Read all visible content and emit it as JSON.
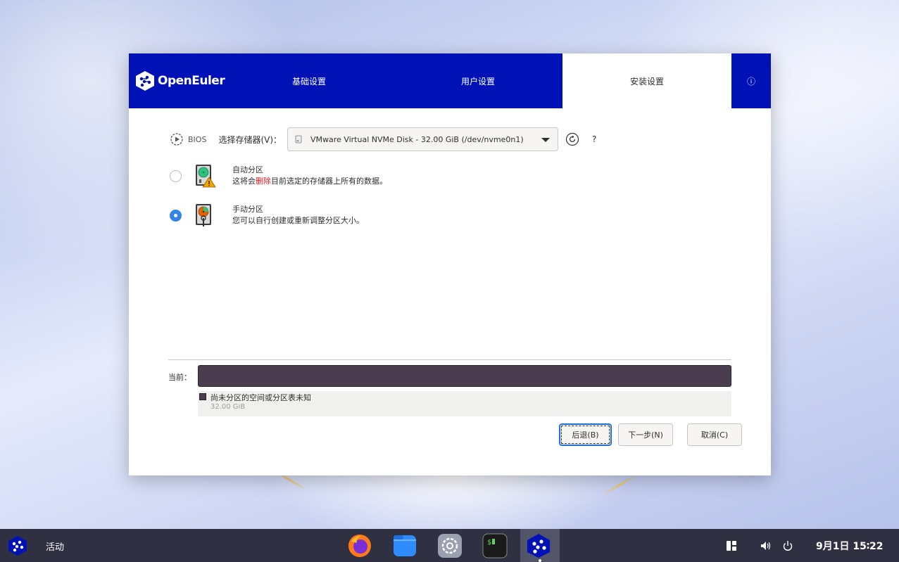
{
  "header": {
    "logo_text": "OpenEuler",
    "tabs": [
      {
        "label": "基础设置",
        "active": false
      },
      {
        "label": "用户设置",
        "active": false
      },
      {
        "label": "安装设置",
        "active": true
      }
    ],
    "info_label": "ⓘ"
  },
  "storage": {
    "firmware": "BIOS",
    "select_label": "选择存储器(V)：",
    "selected_disk": "VMware Virtual NVMe Disk - 32.00 GiB (/dev/nvme0n1)",
    "help_label": "?"
  },
  "options": [
    {
      "title": "自动分区",
      "desc_before": "这将会",
      "desc_warn": "删除",
      "desc_after": "目前选定的存储器上所有的数据。",
      "checked": false
    },
    {
      "title": "手动分区",
      "desc": "您可以自行创建或重新调整分区大小。",
      "checked": true
    }
  ],
  "current": {
    "label": "当前：",
    "legend_title": "尚未分区的空间或分区表未知",
    "legend_size": "32.00 GiB",
    "bar_color": "#4a3d4f"
  },
  "buttons": {
    "back": "后退(B)",
    "next": "下一步(N)",
    "cancel": "取消(C)"
  },
  "taskbar": {
    "activities": "活动",
    "clock": "9月1日  15∶22"
  },
  "colors": {
    "header_bg": "#0012b5",
    "radio_accent": "#3584e4",
    "warn_text": "#e01b24",
    "taskbar_bg": "#2f3142"
  }
}
